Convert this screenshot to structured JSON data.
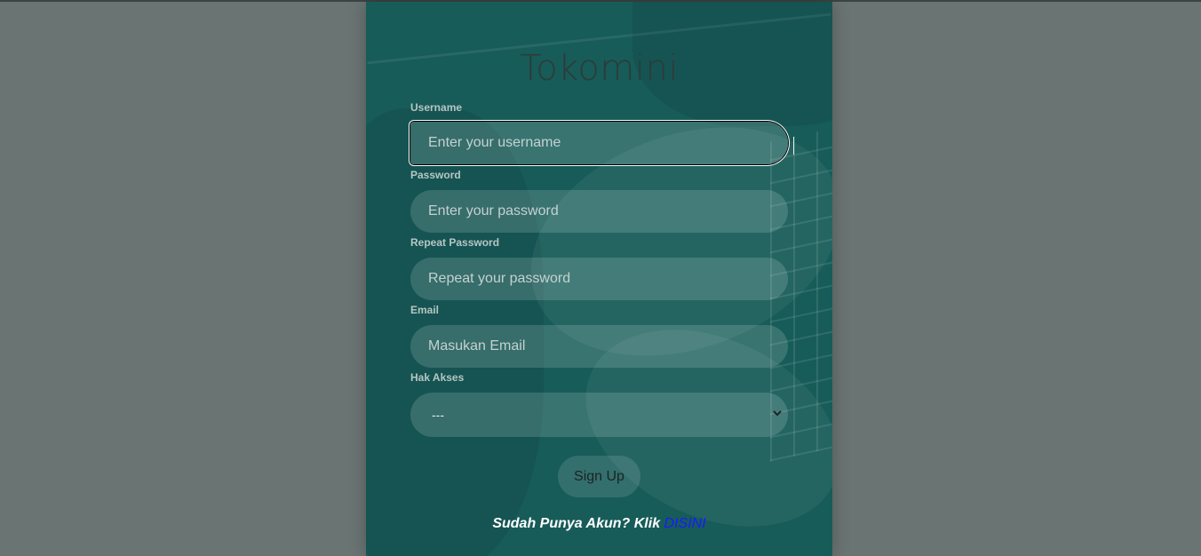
{
  "app": {
    "title": "Tokomini"
  },
  "form": {
    "username": {
      "label": "Username",
      "placeholder": "Enter your username",
      "value": ""
    },
    "password": {
      "label": "Password",
      "placeholder": "Enter your password",
      "value": ""
    },
    "repeat_password": {
      "label": "Repeat Password",
      "placeholder": "Repeat your password",
      "value": ""
    },
    "email": {
      "label": "Email",
      "placeholder": "Masukan Email",
      "value": ""
    },
    "access": {
      "label": "Hak Akses",
      "selected": "---"
    },
    "submit_label": "Sign Up"
  },
  "footer": {
    "text": "Sudah Punya Akun? Klik",
    "link_text": "DISINI"
  },
  "colors": {
    "card": "#175c59",
    "page": "#6a7472",
    "link": "#1a1aff"
  },
  "icons": {
    "select_arrow": "chevron-down-icon"
  }
}
